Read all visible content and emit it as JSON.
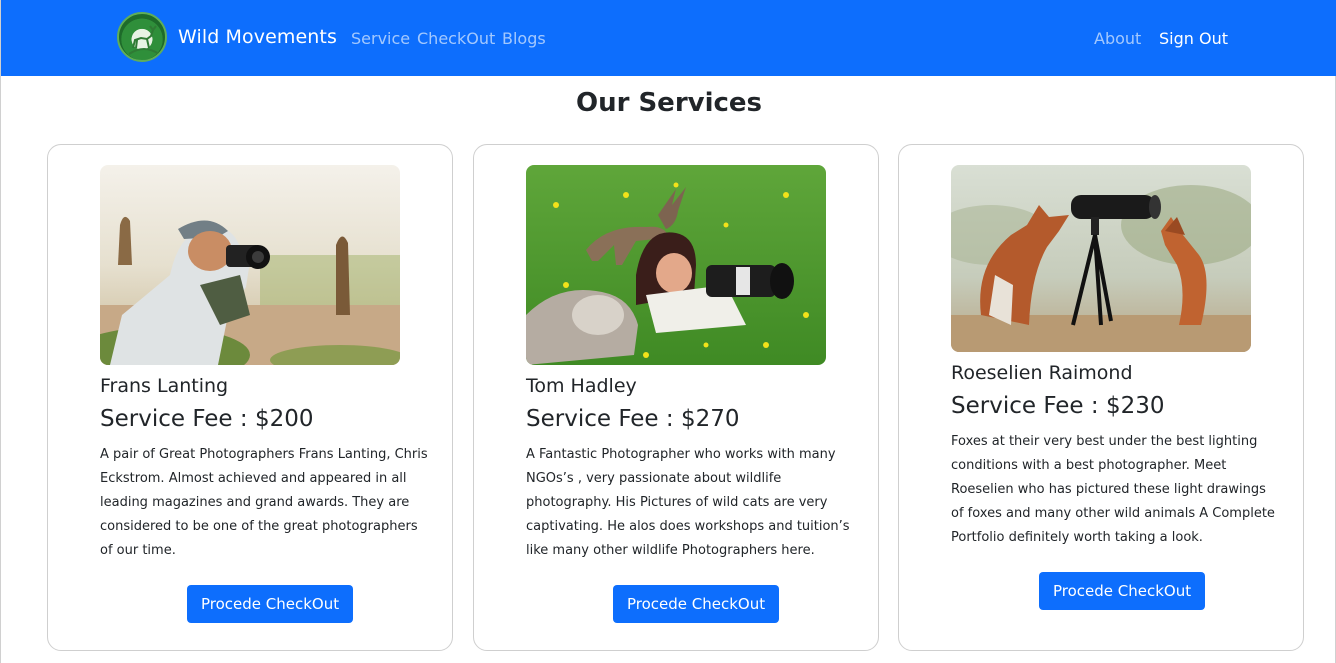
{
  "brand": {
    "name": "Wild Movements",
    "logo_icon": "deer-logo-icon"
  },
  "nav": {
    "left": [
      "Service",
      "CheckOut",
      "Blogs"
    ],
    "right": [
      "About",
      "Sign Out"
    ]
  },
  "colors": {
    "primary": "#0d6efd",
    "text": "#212529"
  },
  "page_title": "Our Services",
  "cards": [
    {
      "name": "Frans Lanting",
      "fee": "Service Fee : $200",
      "description": "A pair of Great Photographers Frans Lanting, Chris Eckstrom. Almost achieved and appeared in all leading magazines and grand awards. They are considered to be one of the great photographers of our time.",
      "button": "Procede CheckOut",
      "image": "photographer-with-meerkats-photo"
    },
    {
      "name": "Tom Hadley",
      "fee": "Service Fee : $270",
      "description": "A Fantastic Photographer who works with many NGOs’s , very passionate about wildlife photography. His Pictures of wild cats are very captivating. He alos does workshops and tuition’s like many other wildlife Photographers here.",
      "button": "Procede CheckOut",
      "image": "photographer-with-fawn-and-wolf-pup-photo"
    },
    {
      "name": "Roeselien Raimond",
      "fee": "Service Fee : $230",
      "description": "Foxes at their very best under the best lighting conditions with a best photographer. Meet Roeselien who has pictured these light drawings of foxes and many other wild animals A Complete Portfolio definitely worth taking a look.",
      "button": "Procede CheckOut",
      "image": "foxes-with-camera-tripod-photo"
    }
  ]
}
